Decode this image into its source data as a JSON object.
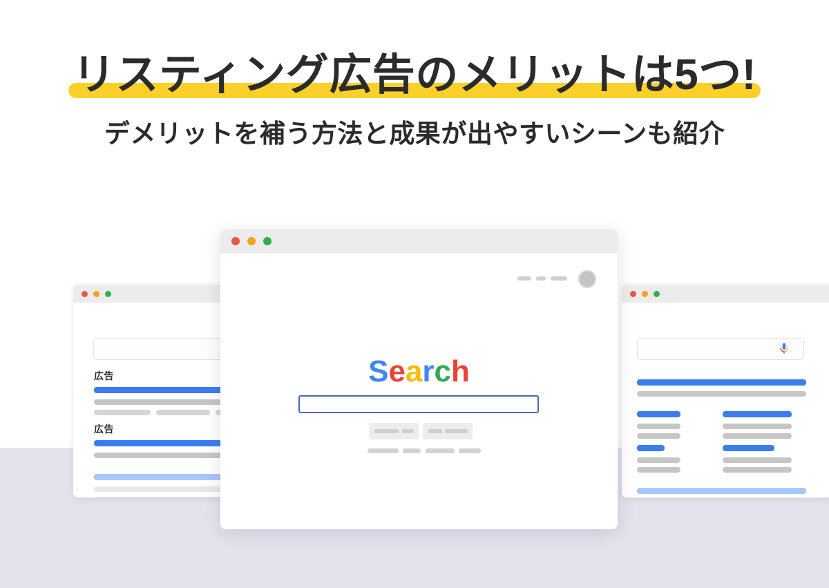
{
  "page": {
    "background_color": "#ffffff",
    "band_color": "#e3e3ed"
  },
  "headline": {
    "main": "リスティング広告のメリットは5つ!",
    "sub": "デメリットを補う方法と成果が出やすいシーンも紹介",
    "highlight_color": "#fbd02a",
    "text_color": "#2b2b2b"
  },
  "windows": {
    "left": {
      "name": "left-browser-window",
      "traffic_lights": [
        "red",
        "yellow",
        "green"
      ],
      "ad_labels": [
        "広告",
        "広告"
      ],
      "search_value": "",
      "search_placeholder": ""
    },
    "center": {
      "name": "center-browser-window",
      "traffic_lights": [
        "red",
        "yellow",
        "green"
      ],
      "logo": {
        "text": "Search",
        "letters": [
          {
            "char": "S",
            "color": "#4285f4"
          },
          {
            "char": "e",
            "color": "#ea4335"
          },
          {
            "char": "a",
            "color": "#fbbc05"
          },
          {
            "char": "r",
            "color": "#4285f4"
          },
          {
            "char": "c",
            "color": "#34a853"
          },
          {
            "char": "h",
            "color": "#ea4335"
          }
        ]
      },
      "search_value": "",
      "search_placeholder": "",
      "search_border_color": "#4669bd",
      "nav_dashes": 3,
      "avatar": "user-avatar"
    },
    "right": {
      "name": "right-browser-window",
      "traffic_lights": [
        "red",
        "yellow",
        "green"
      ],
      "search_value": "",
      "search_placeholder": "",
      "mic_icon": "microphone-icon",
      "mic_colors": {
        "body": "#4285f4",
        "left": "#ea4335",
        "right": "#fbbc05",
        "stem": "#34a853"
      }
    }
  },
  "colors": {
    "link_blue": "#3b7def",
    "visited_blue": "#a8c7fa",
    "text_gray": "#c6c6c6",
    "faint_gray": "#e8e8e8",
    "dot_red": "#e8574a",
    "dot_yellow": "#f5a01f",
    "dot_green": "#2eb14a"
  }
}
